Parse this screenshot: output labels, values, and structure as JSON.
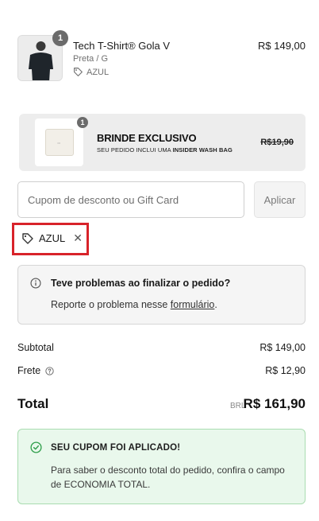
{
  "product": {
    "quantity": "1",
    "name": "Tech T-Shirt® Gola V",
    "variant": "Preta / G",
    "tag": "AZUL",
    "price": "R$ 149,00"
  },
  "gift": {
    "quantity": "1",
    "title": "BRINDE EXCLUSIVO",
    "subtitle_prefix": "SEU PEDIDO INCLUI UMA",
    "subtitle_bold": "INSIDER WASH BAG",
    "price": "R$19,90"
  },
  "coupon": {
    "placeholder": "Cupom de desconto ou Gift Card",
    "value": "",
    "apply_label": "Aplicar"
  },
  "applied_coupon": {
    "code": "AZUL"
  },
  "help": {
    "title": "Teve problemas ao finalizar o pedido?",
    "text_prefix": "Reporte o problema nesse",
    "link": "formulário",
    "text_suffix": "."
  },
  "summary": {
    "subtotal_label": "Subtotal",
    "subtotal_value": "R$ 149,00",
    "shipping_label": "Frete",
    "shipping_value": "R$ 12,90",
    "total_label": "Total",
    "total_currency": "BRL",
    "total_value": "R$ 161,90"
  },
  "success": {
    "title": "SEU CUPOM FOI APLICADO!",
    "text": "Para saber o desconto total do pedido, confira o campo de ECONOMIA TOTAL."
  },
  "colors": {
    "highlight_outline": "#d8232a",
    "success_bg": "#e9f8ec",
    "success_border": "#a9dcb0",
    "success_icon": "#2e9e4a"
  },
  "icons": {
    "tag": "tag-icon",
    "close": "close-icon",
    "info": "info-icon",
    "help": "help-circle-icon",
    "check": "check-circle-icon"
  }
}
